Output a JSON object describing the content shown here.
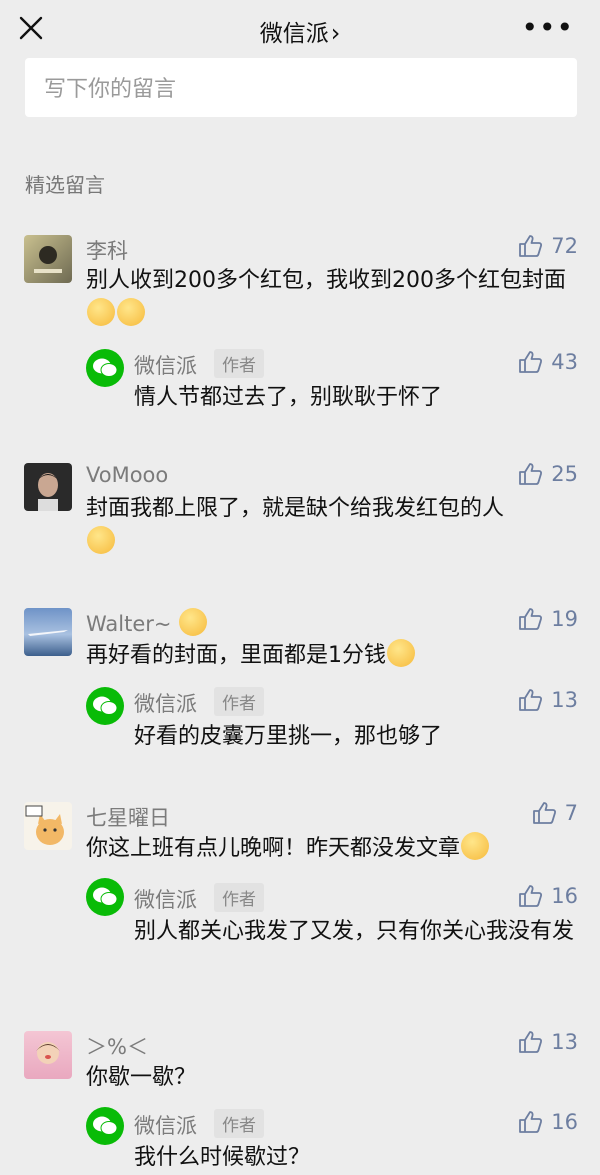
{
  "header": {
    "title": "微信派",
    "chevron": "›",
    "close_icon": "close-icon",
    "more_icon": "more-icon"
  },
  "compose": {
    "placeholder": "写下你的留言"
  },
  "section": {
    "title": "精选留言"
  },
  "comments": [
    {
      "user": "李科",
      "likes": "72",
      "text": "别人收到200多个红包，我收到200多个红包封面",
      "reply": {
        "user": "微信派",
        "tag": "作者",
        "likes": "43",
        "text": "情人节都过去了，别耿耿于怀了"
      }
    },
    {
      "user": "VoMooo",
      "likes": "25",
      "text": "封面我都上限了，就是缺个给我发红包的人"
    },
    {
      "user": "Walter~",
      "likes": "19",
      "text": "再好看的封面，里面都是1分钱",
      "reply": {
        "user": "微信派",
        "tag": "作者",
        "likes": "13",
        "text": "好看的皮囊万里挑一，那也够了"
      }
    },
    {
      "user": "七星曜日",
      "likes": "7",
      "text": "你这上班有点儿晚啊！昨天都没发文章",
      "reply": {
        "user": "微信派",
        "tag": "作者",
        "likes": "16",
        "text": "别人都关心我发了又发，只有你关心我没有发"
      }
    },
    {
      "user": "＞%＜",
      "likes": "13",
      "text": "你歇一歇？",
      "reply": {
        "user": "微信派",
        "tag": "作者",
        "likes": "16",
        "text": "我什么时候歇过？"
      }
    }
  ]
}
